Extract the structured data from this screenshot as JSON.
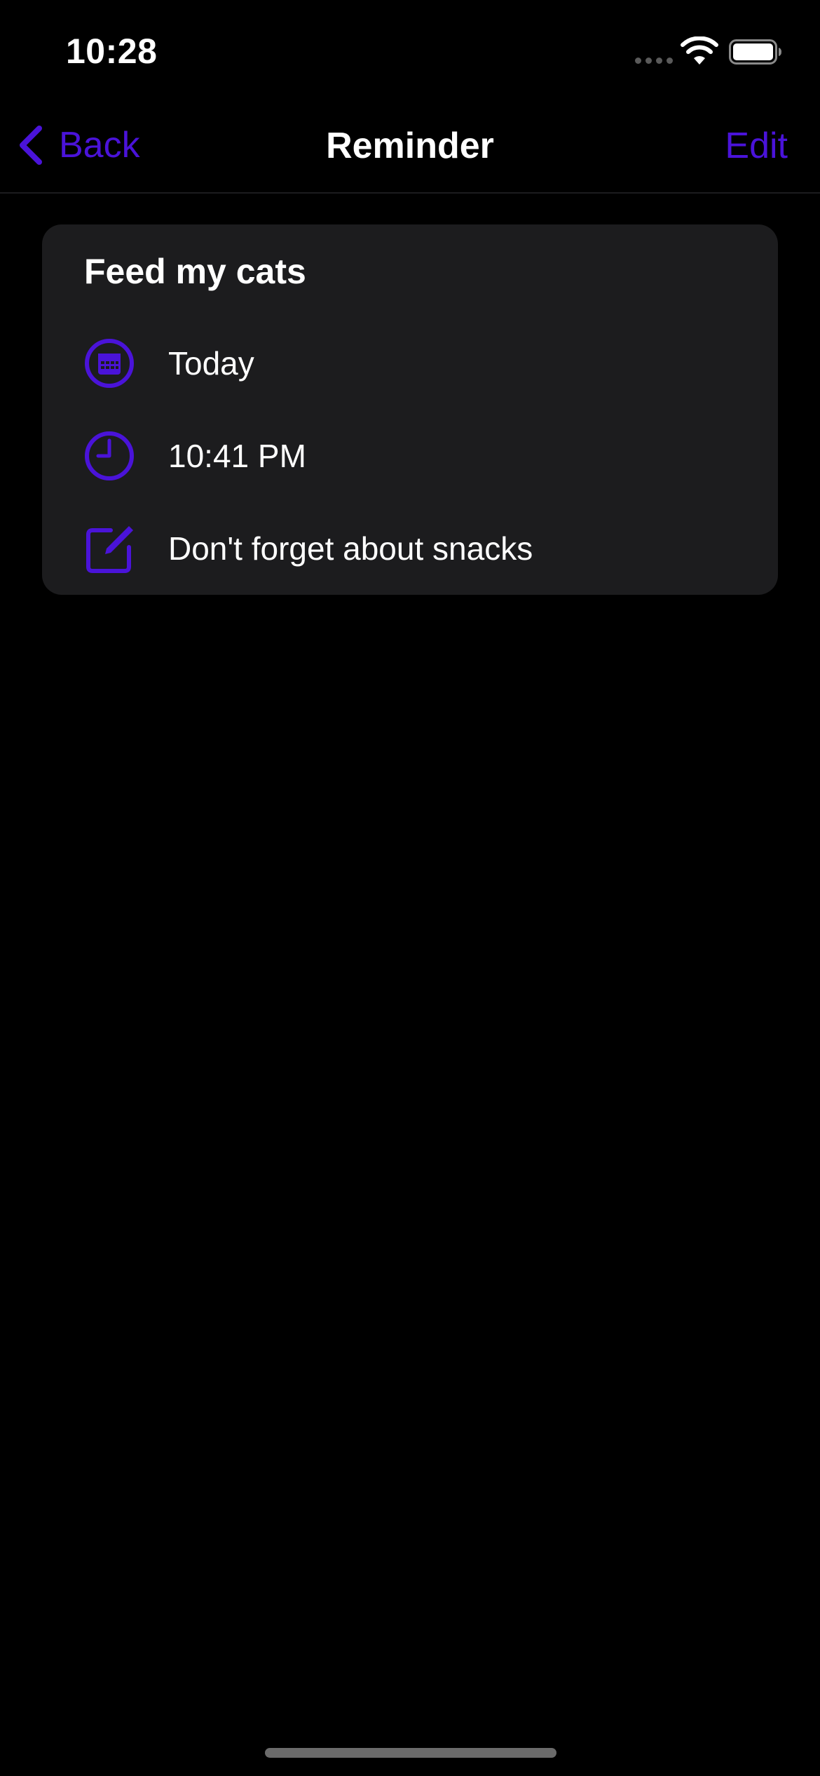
{
  "status_bar": {
    "time": "10:28"
  },
  "nav": {
    "back_label": "Back",
    "title": "Reminder",
    "edit_label": "Edit"
  },
  "reminder": {
    "title": "Feed my cats",
    "date": "Today",
    "time": "10:41 PM",
    "note": "Don't forget about snacks"
  },
  "icons": {
    "back": "chevron-left-icon",
    "date": "calendar-icon",
    "time": "clock-icon",
    "note": "compose-icon"
  },
  "colors": {
    "accent": "#4a13d9",
    "background": "#000000",
    "card": "#1c1c1e",
    "text": "#ffffff"
  }
}
